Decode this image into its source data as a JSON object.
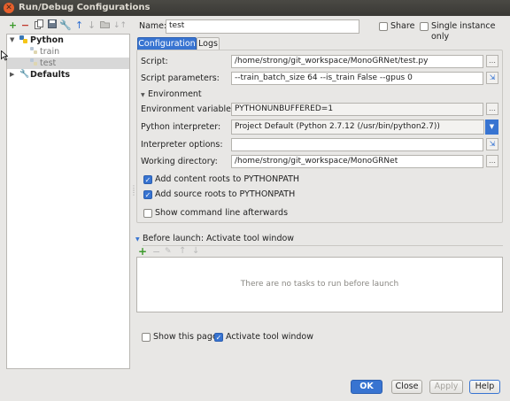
{
  "window": {
    "title": "Run/Debug Configurations"
  },
  "toolbar": {
    "icons": [
      "plus-icon",
      "minus-icon",
      "copy-icon",
      "save-icon",
      "wrench-icon",
      "arrow-up-icon",
      "arrow-down-icon",
      "folder-icon",
      "sort-icon"
    ]
  },
  "tree": {
    "python_label": "Python",
    "items": [
      {
        "label": "train"
      },
      {
        "label": "test"
      }
    ],
    "defaults_label": "Defaults"
  },
  "name": {
    "label": "Name:",
    "value": "test"
  },
  "share": {
    "label": "Share",
    "checked": false
  },
  "single_instance": {
    "label": "Single instance only",
    "checked": false
  },
  "tabs": [
    {
      "label": "Configuration",
      "active": true
    },
    {
      "label": "Logs",
      "active": false
    }
  ],
  "config": {
    "script_label": "Script:",
    "script_value": "/home/strong/git_workspace/MonoGRNet/test.py",
    "params_label": "Script parameters:",
    "params_value": "--train_batch_size 64 --is_train False --gpus 0",
    "environment_header": "Environment",
    "env_vars_label": "Environment variables:",
    "env_vars_value": "PYTHONUNBUFFERED=1",
    "interpreter_label": "Python interpreter:",
    "interpreter_value": "Project Default (Python 2.7.12 (/usr/bin/python2.7))",
    "interp_options_label": "Interpreter options:",
    "interp_options_value": "",
    "workdir_label": "Working directory:",
    "workdir_value": "/home/strong/git_workspace/MonoGRNet",
    "content_roots_label": "Add content roots to PYTHONPATH",
    "source_roots_label": "Add source roots to PYTHONPATH",
    "show_cmd_label": "Show command line afterwards"
  },
  "before_launch": {
    "header": "Before launch: Activate tool window",
    "empty_text": "There are no tasks to run before launch"
  },
  "show_page": {
    "label": "Show this page",
    "checked": false
  },
  "activate_tool": {
    "label": "Activate tool window",
    "checked": true
  },
  "buttons": {
    "ok": "OK",
    "close": "Close",
    "apply": "Apply",
    "help": "Help"
  },
  "colors": {
    "accent": "#3874d1",
    "titlebar": "#3c3b37",
    "selection": "#d8d8d8",
    "close": "#e8602c"
  }
}
